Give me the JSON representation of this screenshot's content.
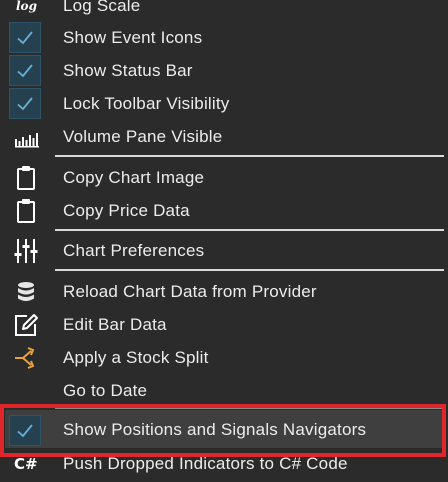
{
  "menu": {
    "items": [
      {
        "label": "Log Scale",
        "icon": "log-icon",
        "checked": false
      },
      {
        "label": "Show Event Icons",
        "icon": "",
        "checked": true
      },
      {
        "label": "Show Status Bar",
        "icon": "",
        "checked": true
      },
      {
        "label": "Lock Toolbar Visibility",
        "icon": "",
        "checked": true
      },
      {
        "label": "Volume Pane Visible",
        "icon": "volume-bars-icon",
        "checked": false
      },
      {
        "label": "Copy Chart Image",
        "icon": "clipboard-icon",
        "checked": false
      },
      {
        "label": "Copy Price Data",
        "icon": "clipboard-icon",
        "checked": false
      },
      {
        "label": "Chart Preferences",
        "icon": "sliders-icon",
        "checked": false
      },
      {
        "label": "Reload Chart Data from Provider",
        "icon": "database-icon",
        "checked": false
      },
      {
        "label": "Edit Bar Data",
        "icon": "edit-icon",
        "checked": false
      },
      {
        "label": "Apply a Stock Split",
        "icon": "split-icon",
        "checked": false
      },
      {
        "label": "Go to Date",
        "icon": "",
        "checked": false
      },
      {
        "label": "Show Positions and Signals Navigators",
        "icon": "",
        "checked": true,
        "highlighted": true
      },
      {
        "label": "Push Dropped Indicators to C# Code",
        "icon": "csharp-icon",
        "checked": false
      }
    ],
    "log_icon_text": "log",
    "csharp_icon_text": "C#"
  },
  "colors": {
    "background": "#2b2b2b",
    "text": "#ececec",
    "checkbox_fill": "#25414f",
    "checkmark": "#6ab0d6",
    "highlight": "#3f3f3f",
    "annotation_red": "#e0262b",
    "split_icon": "#e8a33c"
  }
}
